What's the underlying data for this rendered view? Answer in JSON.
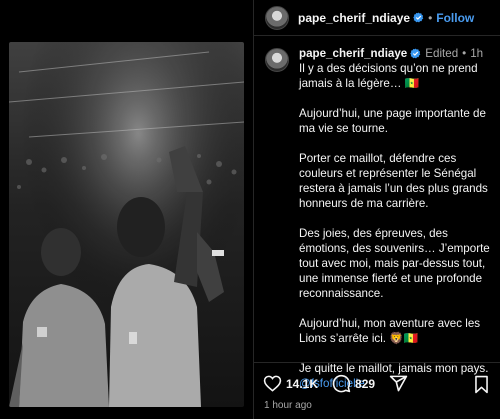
{
  "post": {
    "author": "pape_cherif_ndiaye",
    "follow_label": "Follow",
    "separator": "•",
    "edited_label": "Edited",
    "time_ago_short": "1h",
    "caption_paragraphs": [
      "Il y a des décisions qu’on ne prend jamais à la légère… 🇸🇳",
      "Aujourd’hui, une page importante de ma vie se tourne.",
      "Porter ce maillot, défendre ces couleurs et représenter le Sénégal restera à jamais l’un des plus grands honneurs de ma carrière.",
      "Des joies, des épreuves, des émotions, des souvenirs… J’emporte tout avec moi, mais par-dessus tout, une immense fierté et une profonde reconnaissance.",
      "Aujourd’hui, mon aventure avec les Lions s’arrête ici. 🦁🇸🇳",
      "Je quitte le maillot, jamais mon pays."
    ],
    "mention": "@fsfofficielle",
    "likes": "14.1K",
    "comments": "829",
    "timestamp": "1 hour ago"
  },
  "icons": {
    "verified": "verified-badge-icon",
    "like": "heart-icon",
    "comment": "comment-bubble-icon",
    "share": "share-paper-plane-icon",
    "save": "bookmark-icon"
  },
  "colors": {
    "background": "#000000",
    "link": "#4a9cf0",
    "verified": "#3897f0",
    "muted": "#a8a8a8",
    "divider": "#262626"
  }
}
